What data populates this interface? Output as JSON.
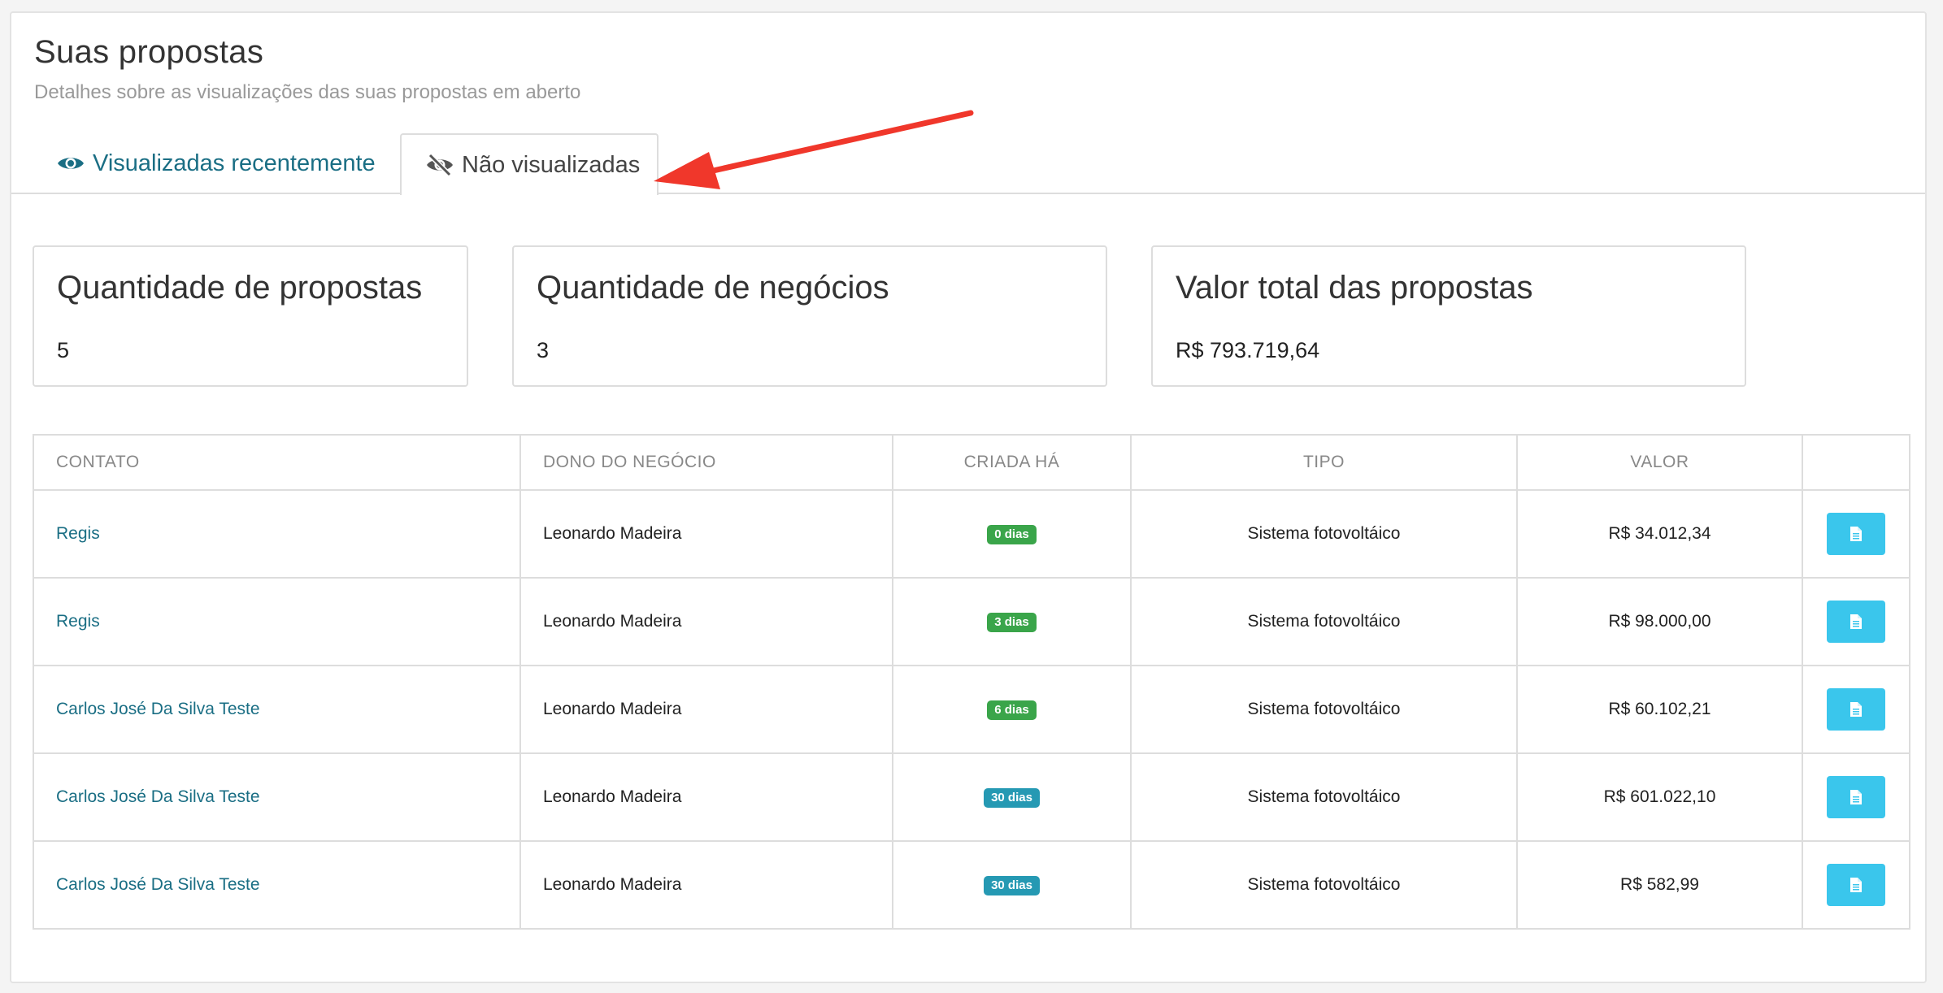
{
  "header": {
    "title": "Suas propostas",
    "subtitle": "Detalhes sobre as visualizações das suas propostas em aberto"
  },
  "tabs": [
    {
      "label": "Visualizadas recentemente",
      "icon": "eye-icon",
      "active": false
    },
    {
      "label": "Não visualizadas",
      "icon": "eye-slash-icon",
      "active": true
    }
  ],
  "stats": {
    "proposals": {
      "label": "Quantidade de propostas",
      "value": "5"
    },
    "deals": {
      "label": "Quantidade de negócios",
      "value": "3"
    },
    "total": {
      "label": "Valor total das propostas",
      "value": "R$ 793.719,64"
    }
  },
  "table": {
    "headers": [
      "CONTATO",
      "DONO DO NEGÓCIO",
      "CRIADA HÁ",
      "TIPO",
      "VALOR",
      ""
    ],
    "rows": [
      {
        "contact": "Regis",
        "owner": "Leonardo Madeira",
        "created": "0 dias",
        "type": "Sistema fotovoltáico",
        "value": "R$ 34.012,34"
      },
      {
        "contact": "Regis",
        "owner": "Leonardo Madeira",
        "created": "3 dias",
        "type": "Sistema fotovoltáico",
        "value": "R$ 98.000,00"
      },
      {
        "contact": "Carlos José Da Silva Teste",
        "owner": "Leonardo Madeira",
        "created": "6 dias",
        "type": "Sistema fotovoltáico",
        "value": "R$ 60.102,21"
      },
      {
        "contact": "Carlos José Da Silva Teste",
        "owner": "Leonardo Madeira",
        "created": "30 dias",
        "type": "Sistema fotovoltáico",
        "value": "R$ 601.022,10"
      },
      {
        "contact": "Carlos José Da Silva Teste",
        "owner": "Leonardo Madeira",
        "created": "30 dias",
        "type": "Sistema fotovoltáico",
        "value": "R$ 582,99"
      }
    ]
  },
  "colors": {
    "link": "#1a6e84",
    "badge_green": "#3aa54a",
    "badge_blue": "#2599b3",
    "action_button": "#3ac6ec",
    "annotation_arrow": "#f0372b"
  }
}
